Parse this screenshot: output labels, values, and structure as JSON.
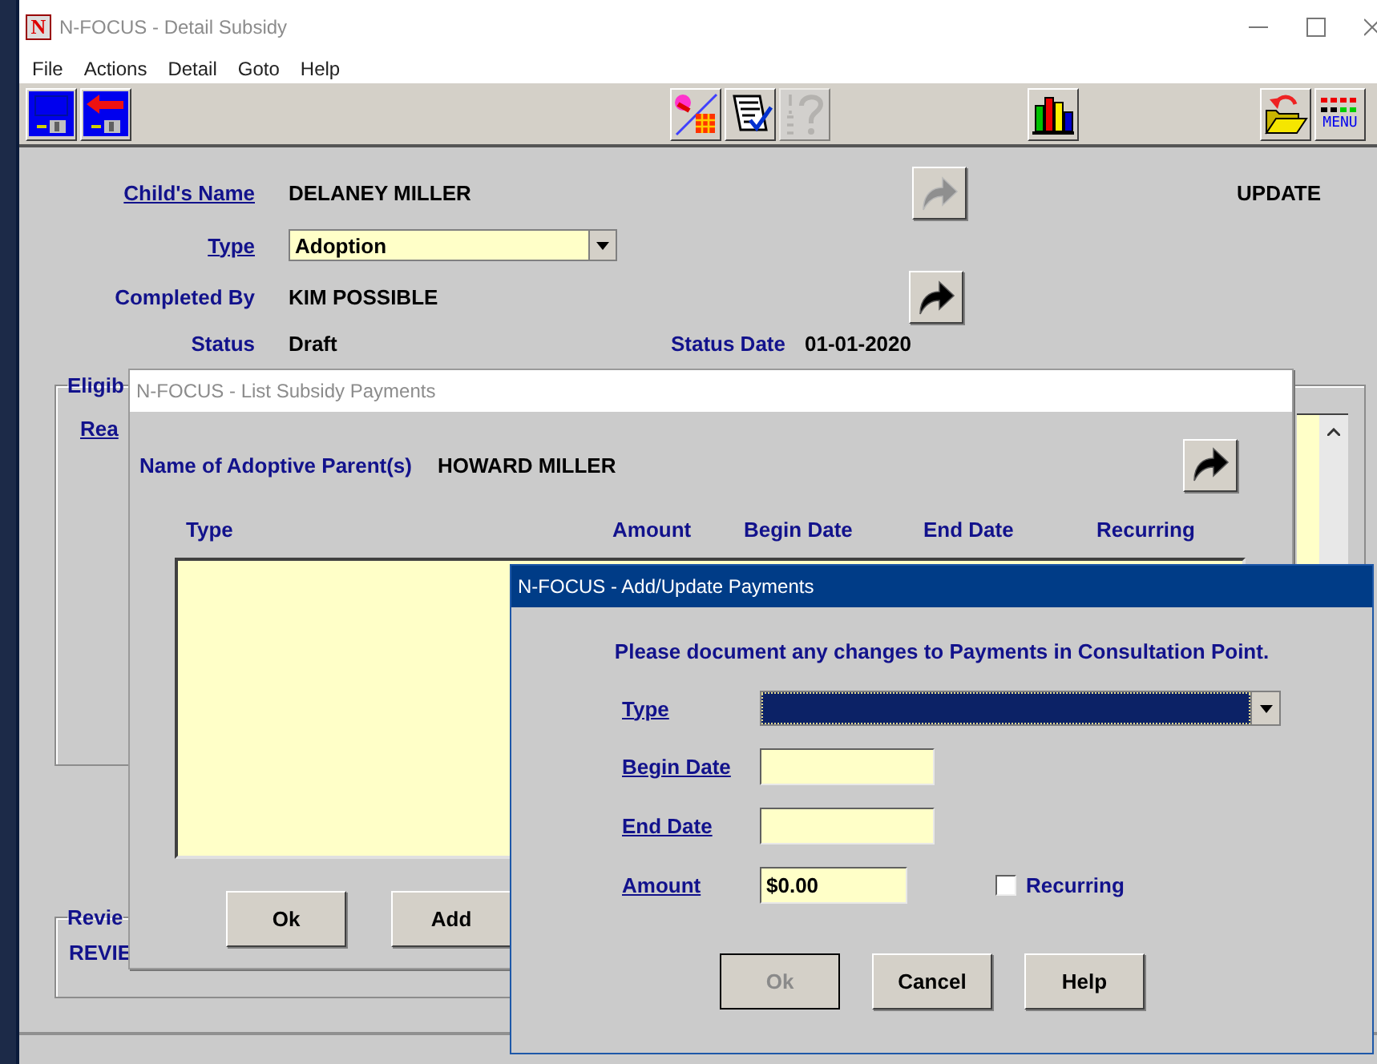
{
  "main_window": {
    "icon_text": "N",
    "title": "N-FOCUS - Detail Subsidy",
    "active": false,
    "menu": [
      "File",
      "Actions",
      "Detail",
      "Goto",
      "Help"
    ],
    "toolbar": [
      {
        "items": [
          {
            "kind": "save",
            "disabled": false
          },
          {
            "kind": "exit",
            "disabled": false
          }
        ]
      },
      {
        "items": [
          {
            "kind": "paint",
            "disabled": false
          },
          {
            "kind": "notes",
            "disabled": false
          },
          {
            "kind": "steps",
            "disabled": true
          }
        ]
      },
      {
        "items": [
          {
            "kind": "chart",
            "disabled": false
          }
        ]
      },
      {
        "items": [
          {
            "kind": "folder",
            "disabled": false
          },
          {
            "kind": "menu",
            "label": "MENU",
            "disabled": false
          }
        ]
      }
    ],
    "mode": "UPDATE",
    "child_name": {
      "label": "Child's Name",
      "value": "DELANEY MILLER",
      "forward_disabled": true
    },
    "type": {
      "label": "Type",
      "value": "Adoption"
    },
    "completed_by": {
      "label": "Completed By",
      "value": "KIM POSSIBLE",
      "forward_disabled": false
    },
    "status": {
      "label": "Status",
      "value": "Draft"
    },
    "status_date": {
      "label": "Status Date",
      "value": "01-01-2020"
    },
    "eligibility_group": {
      "title": "Eligib",
      "reason_label": "Rea"
    },
    "review_group": {
      "title": "Revie",
      "value": "REVIE"
    }
  },
  "list_window": {
    "title": "N-FOCUS - List Subsidy Payments",
    "active": false,
    "parent_label": "Name of Adoptive Parent(s)",
    "parent_value": "HOWARD MILLER",
    "forward_disabled": false,
    "columns": [
      "Type",
      "Amount",
      "Begin Date",
      "End Date",
      "Recurring"
    ],
    "buttons": [
      {
        "label": "Ok"
      },
      {
        "label": "Add"
      }
    ]
  },
  "dialog": {
    "title": "N-FOCUS - Add/Update Payments",
    "active": true,
    "message": "Please document any changes to Payments in Consultation Point.",
    "fields": [
      {
        "kind": "dropdown",
        "label": "Type",
        "focused": true
      },
      {
        "kind": "date",
        "label": "Begin Date"
      },
      {
        "kind": "date",
        "label": "End Date"
      },
      {
        "kind": "amount",
        "label": "Amount",
        "value": "$0.00"
      }
    ],
    "recurring": {
      "label": "Recurring",
      "checked": false
    },
    "buttons": [
      {
        "label": "Ok",
        "disabled": true
      },
      {
        "label": "Cancel",
        "disabled": false
      },
      {
        "label": "Help",
        "disabled": false
      }
    ]
  }
}
